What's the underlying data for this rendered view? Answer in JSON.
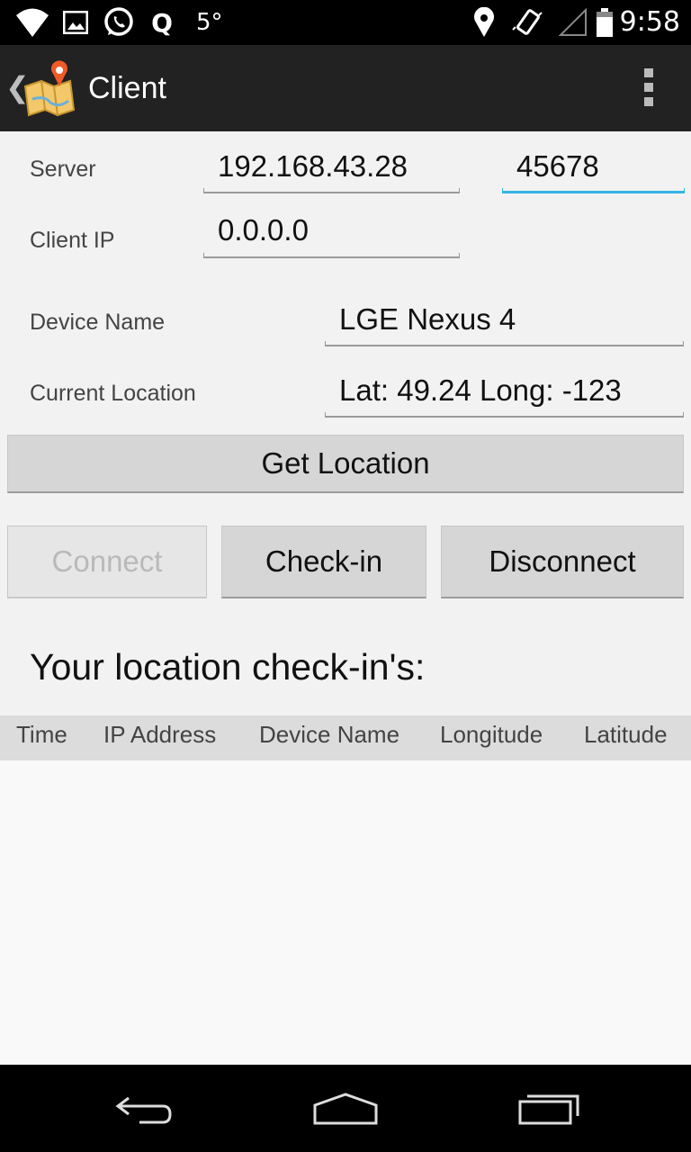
{
  "status_bar": {
    "icons_left": [
      "wifi-icon",
      "image-icon",
      "whatsapp-icon",
      "q-icon"
    ],
    "temperature": "5°",
    "icons_right": [
      "location-pin-icon",
      "vibrate-icon",
      "signal-icon",
      "battery-icon"
    ],
    "time": "9:58"
  },
  "action_bar": {
    "title": "Client",
    "icons": [
      "back-chevron-icon",
      "map-app-icon",
      "overflow-menu-icon"
    ]
  },
  "form": {
    "server_label": "Server",
    "server_ip": "192.168.43.28",
    "server_port": "45678",
    "client_ip_label": "Client IP",
    "client_ip": "0.0.0.0",
    "device_name_label": "Device Name",
    "device_name": "LGE Nexus 4",
    "current_location_label": "Current Location",
    "current_location": "Lat: 49.24 Long: -123"
  },
  "buttons": {
    "get_location": "Get Location",
    "connect": "Connect",
    "checkin": "Check-in",
    "disconnect": "Disconnect"
  },
  "checkins": {
    "title": "Your location check-in's:",
    "columns": [
      "Time",
      "IP Address",
      "Device Name",
      "Longitude",
      "Latitude"
    ],
    "rows": []
  },
  "nav_bar": {
    "icons": [
      "back-icon",
      "home-icon",
      "recents-icon"
    ]
  },
  "colors": {
    "accent": "#33b5e5",
    "action_bar": "#222222",
    "background": "#f2f2f2"
  }
}
